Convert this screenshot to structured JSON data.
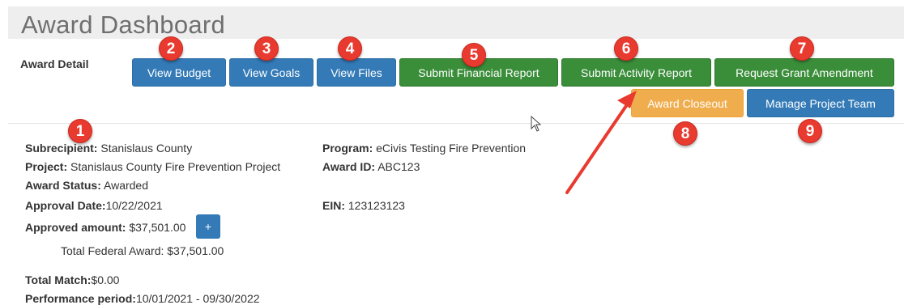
{
  "page": {
    "title": "Award Dashboard"
  },
  "header": {
    "section_label": "Award Detail"
  },
  "buttons": {
    "view_budget": "View Budget",
    "view_goals": "View Goals",
    "view_files": "View Files",
    "submit_financial_report": "Submit Financial Report",
    "submit_activity_report": "Submit Activity Report",
    "request_grant_amendment": "Request Grant Amendment",
    "award_closeout": "Award Closeout",
    "manage_project_team": "Manage Project Team"
  },
  "badges": [
    "1",
    "2",
    "3",
    "4",
    "5",
    "6",
    "7",
    "8",
    "9"
  ],
  "details": {
    "subrecipient": {
      "label": "Subrecipient:",
      "value": " Stanislaus County"
    },
    "project": {
      "label": "Project:",
      "value": " Stanislaus County Fire Prevention Project"
    },
    "award_status": {
      "label": "Award Status:",
      "value": " Awarded"
    },
    "approval_date": {
      "label": "Approval Date:",
      "value": "10/22/2021"
    },
    "approved_amount": {
      "label": "Approved amount:",
      "value": " $37,501.00"
    },
    "plus_label": "+",
    "total_federal_award": "Total Federal Award: $37,501.00",
    "total_match": {
      "label": "Total Match:",
      "value": "$0.00"
    },
    "performance_period": {
      "label": "Performance period:",
      "value": "10/01/2021 - 09/30/2022"
    },
    "program": {
      "label": "Program:",
      "value": " eCivis Testing Fire Prevention"
    },
    "award_id": {
      "label": "Award ID:",
      "value": " ABC123"
    },
    "ein": {
      "label": "EIN:",
      "value": " 123123123"
    }
  },
  "colors": {
    "primary_blue": "#337ab7",
    "success_green": "#3a8e3a",
    "warning_orange": "#f0ad4e",
    "badge_red": "#e93a2f"
  }
}
